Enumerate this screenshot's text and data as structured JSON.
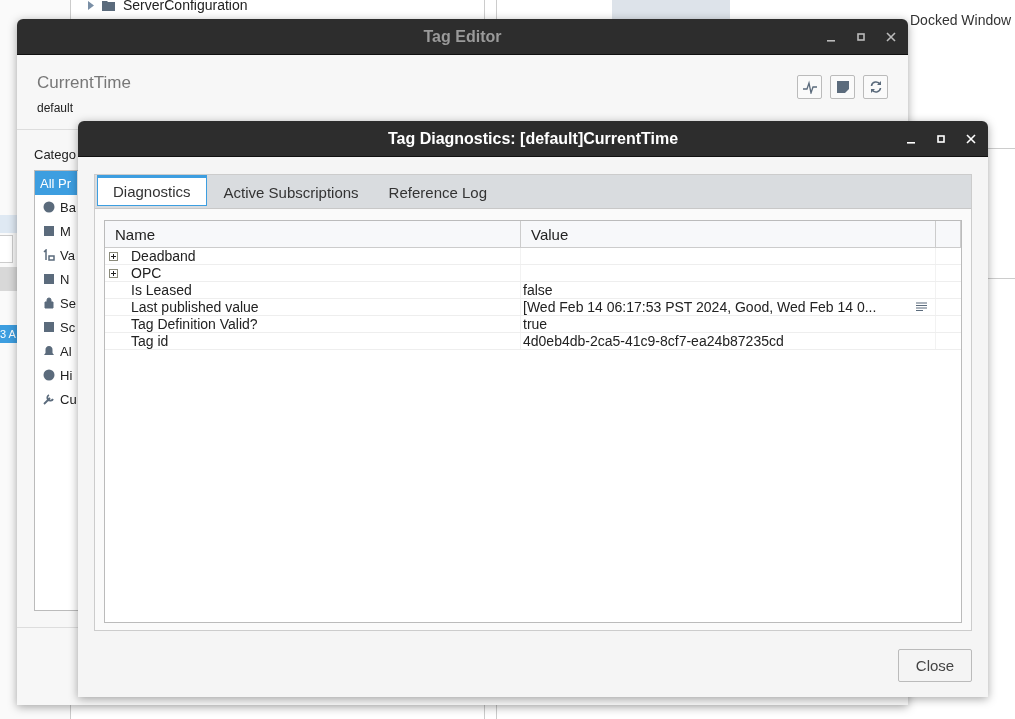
{
  "background": {
    "tree_items": [
      {
        "label": "ServerConfiguration"
      }
    ],
    "tabs": [
      {
        "label": "Docked Window",
        "selected": false
      }
    ],
    "list_fragment": {
      "label": "3 A",
      "selected": true
    }
  },
  "tag_editor": {
    "title": "Tag Editor",
    "tag_name": "CurrentTime",
    "provider": "default",
    "category_heading": "Catego",
    "categories": [
      {
        "label": "All Pr",
        "selected": true
      },
      {
        "label": "Ba",
        "selected": false
      },
      {
        "label": "M",
        "selected": false
      },
      {
        "label": "Va",
        "selected": false
      },
      {
        "label": "N",
        "selected": false
      },
      {
        "label": "Se",
        "selected": false
      },
      {
        "label": "Sc",
        "selected": false
      },
      {
        "label": "Al",
        "selected": false
      },
      {
        "label": "Hi",
        "selected": false
      },
      {
        "label": "Cu",
        "selected": false
      }
    ]
  },
  "diagnostics": {
    "title": "Tag Diagnostics: [default]CurrentTime",
    "tabs": [
      {
        "label": "Diagnostics",
        "selected": true
      },
      {
        "label": "Active Subscriptions",
        "selected": false
      },
      {
        "label": "Reference Log",
        "selected": false
      }
    ],
    "columns": [
      "Name",
      "Value"
    ],
    "rows": [
      {
        "name": "Deadband",
        "expandable": true,
        "detail": false
      },
      {
        "name": "OPC",
        "expandable": true,
        "detail": false
      },
      {
        "name": "Is Leased",
        "value": "false",
        "expandable": false,
        "detail": false
      },
      {
        "name": "Last published value",
        "value": "[Wed Feb 14 06:17:53 PST 2024, Good, Wed Feb 14 0...",
        "expandable": false,
        "detail": true
      },
      {
        "name": "Tag Definition Valid?",
        "value": "true",
        "expandable": false,
        "detail": false
      },
      {
        "name": "Tag id",
        "value": "4d0eb4db-2ca5-41c9-8cf7-ea24b87235cd",
        "expandable": false,
        "detail": false
      }
    ],
    "close_button": "Close"
  }
}
